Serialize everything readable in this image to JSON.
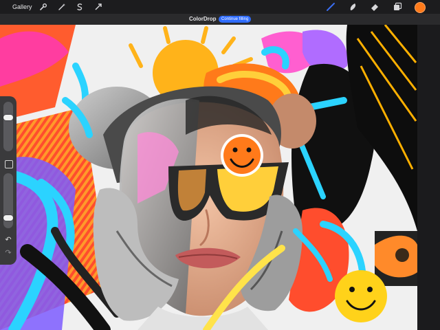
{
  "app": {
    "gallery_label": "Gallery",
    "document_title": "ColorDrop",
    "color_drop_pill": "Continue filling",
    "accent_color": "#2f6cff",
    "brush_active_color": "#3a6df0",
    "current_color": "#ff7a1a"
  },
  "toolbar_left": [
    {
      "name": "wrench-icon"
    },
    {
      "name": "magic-wand-icon"
    },
    {
      "name": "selection-icon"
    },
    {
      "name": "transform-arrow-icon"
    }
  ],
  "toolbar_right": [
    {
      "name": "brush-icon"
    },
    {
      "name": "smudge-icon"
    },
    {
      "name": "eraser-icon"
    },
    {
      "name": "layers-icon"
    }
  ],
  "sidebar": {
    "brush_size_level": 0.7,
    "opacity_level": 0.15
  }
}
